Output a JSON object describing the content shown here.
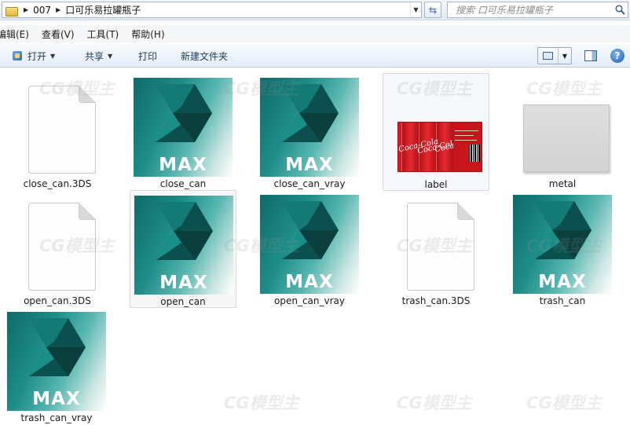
{
  "address_bar": {
    "breadcrumbs": [
      "007",
      "口可乐易拉罐瓶子"
    ],
    "search_placeholder": "搜索 口可乐易拉罐瓶子"
  },
  "menu": [
    "编辑(E)",
    "查看(V)",
    "工具(T)",
    "帮助(H)"
  ],
  "toolbar": {
    "open": "打开",
    "share": "共享",
    "print": "打印",
    "new_folder": "新建文件夹"
  },
  "files": [
    {
      "name": "close_can.3DS",
      "type": "document"
    },
    {
      "name": "close_can",
      "type": "max"
    },
    {
      "name": "close_can_vray",
      "type": "max"
    },
    {
      "name": "label",
      "type": "image",
      "state": "selected"
    },
    {
      "name": "metal",
      "type": "image"
    },
    {
      "name": "open_can.3DS",
      "type": "document"
    },
    {
      "name": "open_can",
      "type": "max",
      "state": "hover"
    },
    {
      "name": "open_can_vray",
      "type": "max"
    },
    {
      "name": "trash_can.3DS",
      "type": "document"
    },
    {
      "name": "trash_can",
      "type": "max"
    },
    {
      "name": "trash_can_vray",
      "type": "max"
    }
  ],
  "icon_text": {
    "max": "MAX",
    "coke": "Coca-Cola"
  },
  "watermark": "CG模型主",
  "colors": {
    "max_teal": "#1e8d89",
    "coke_red": "#d51a22",
    "metal_gray": "#d8d8d8"
  }
}
